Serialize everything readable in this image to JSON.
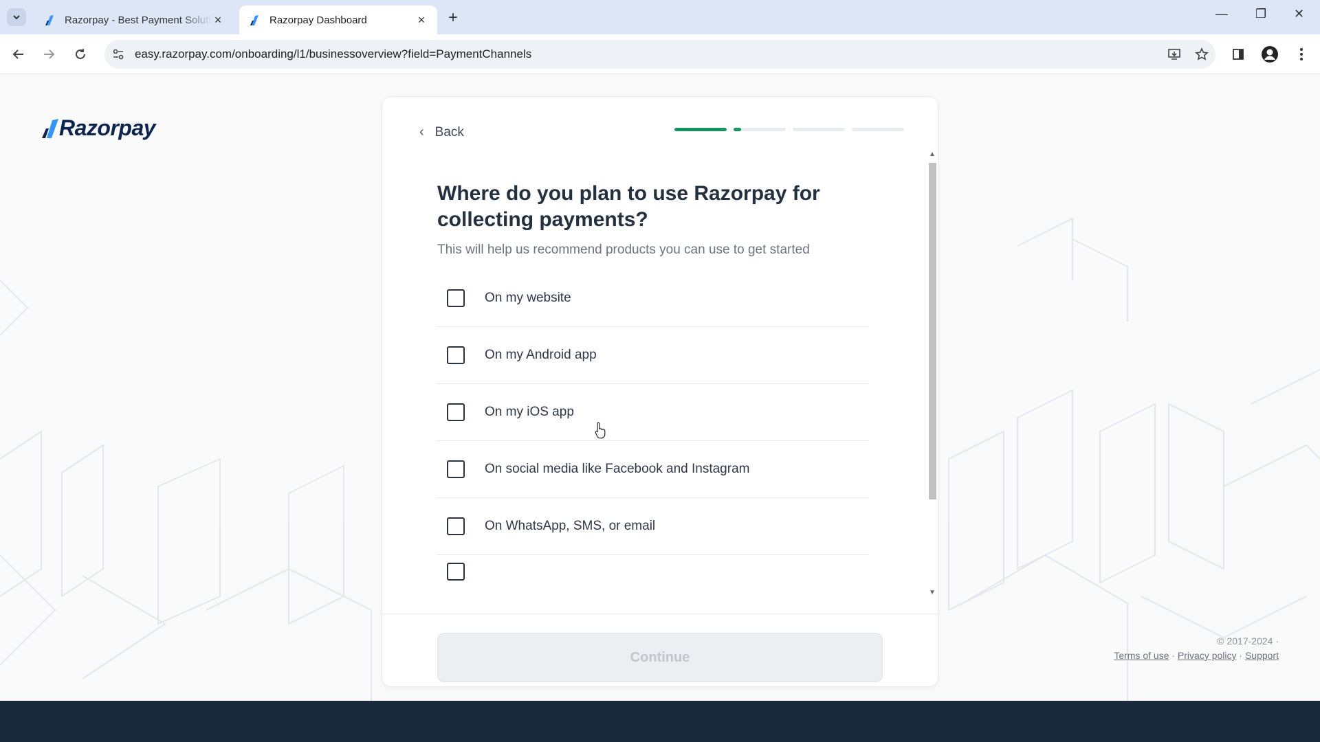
{
  "browser": {
    "tabs": [
      {
        "title": "Razorpay - Best Payment Soluti",
        "active": false
      },
      {
        "title": "Razorpay Dashboard",
        "active": true
      }
    ],
    "url": "easy.razorpay.com/onboarding/l1/businessoverview?field=PaymentChannels"
  },
  "page": {
    "logo_text": "Razorpay",
    "back_label": "Back",
    "progress": [
      1.0,
      0.15,
      0.0,
      0.0
    ],
    "question": "Where do you plan to use Razorpay for collecting payments?",
    "subtitle": "This will help us recommend products you can use to get started",
    "options": [
      {
        "label": "On my website",
        "checked": false
      },
      {
        "label": "On my Android app",
        "checked": false
      },
      {
        "label": "On my iOS app",
        "checked": false
      },
      {
        "label": "On social media like Facebook and Instagram",
        "checked": false
      },
      {
        "label": "On WhatsApp, SMS, or email",
        "checked": false
      }
    ],
    "continue_label": "Continue",
    "copyright": "© 2017-2024 ·",
    "links": {
      "terms": "Terms of use",
      "privacy": "Privacy policy",
      "support": "Support"
    }
  },
  "colors": {
    "accent": "#15935b",
    "brand": "#0c2451",
    "footer_band": "#17293a"
  }
}
